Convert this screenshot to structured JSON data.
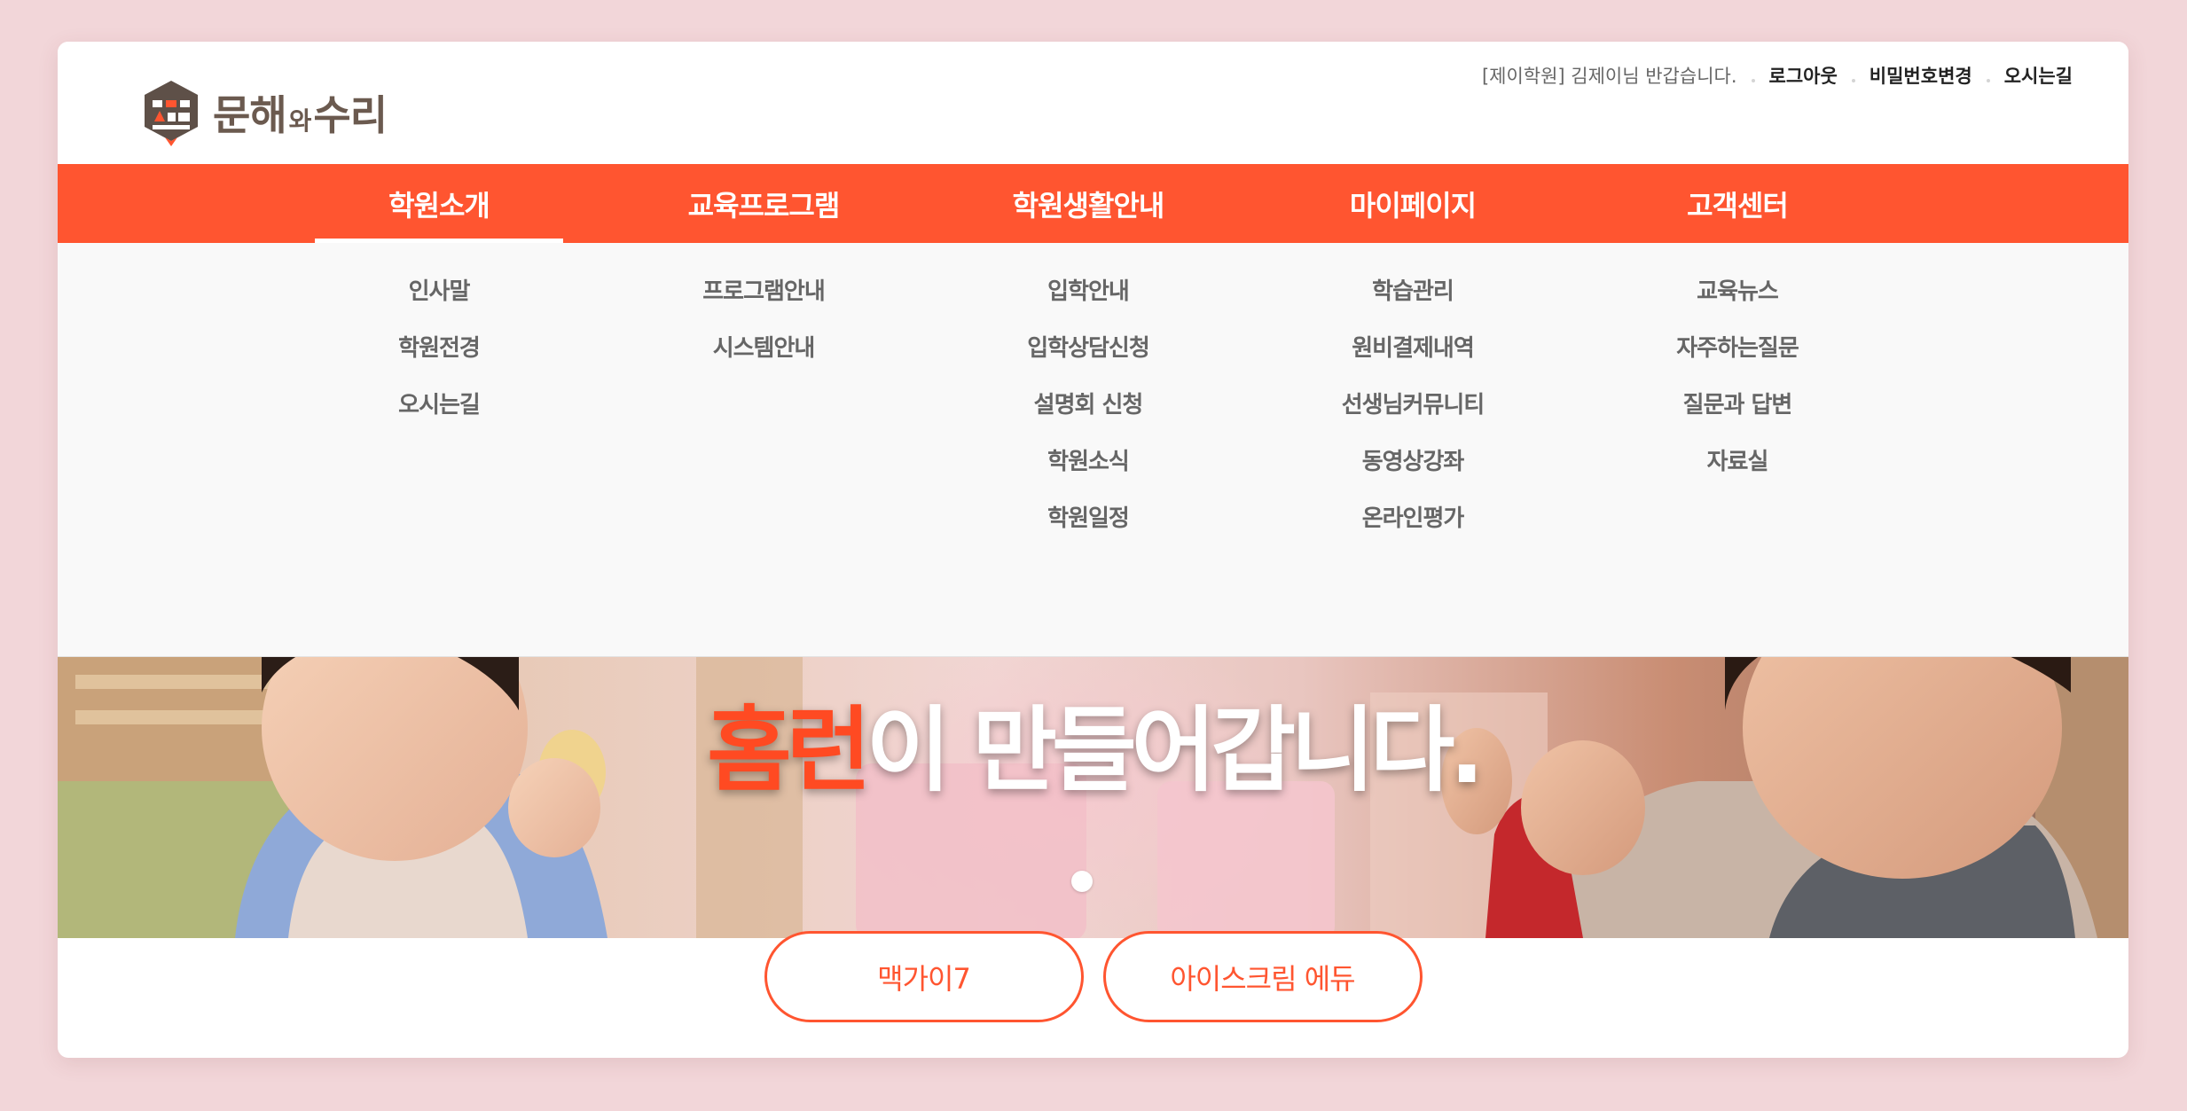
{
  "brand": {
    "name_part1": "문해",
    "name_small": "와",
    "name_part2": "수리",
    "accent_color": "#ff5530"
  },
  "utility": {
    "greeting": "[제이학원] 김제이님 반갑습니다.",
    "logout": "로그아웃",
    "change_password": "비밀번호변경",
    "directions": "오시는길"
  },
  "gnb": [
    {
      "label": "학원소개",
      "active": true
    },
    {
      "label": "교육프로그램",
      "active": false
    },
    {
      "label": "학원생활안내",
      "active": false
    },
    {
      "label": "마이페이지",
      "active": false
    },
    {
      "label": "고객센터",
      "active": false
    }
  ],
  "submenus": [
    [
      "인사말",
      "학원전경",
      "오시는길"
    ],
    [
      "프로그램안내",
      "시스템안내"
    ],
    [
      "입학안내",
      "입학상담신청",
      "설명회 신청",
      "학원소식",
      "학원일정"
    ],
    [
      "학습관리",
      "원비결제내역",
      "선생님커뮤니티",
      "동영상강좌",
      "온라인평가"
    ],
    [
      "교육뉴스",
      "자주하는질문",
      "질문과 답변",
      "자료실"
    ]
  ],
  "hero": {
    "title_accent": "홈런",
    "title_rest": "이 만들어갑니다.",
    "slide_count": 1,
    "active_slide": 1
  },
  "buttons": {
    "left": "맥가이7",
    "right": "아이스크림 에듀"
  }
}
